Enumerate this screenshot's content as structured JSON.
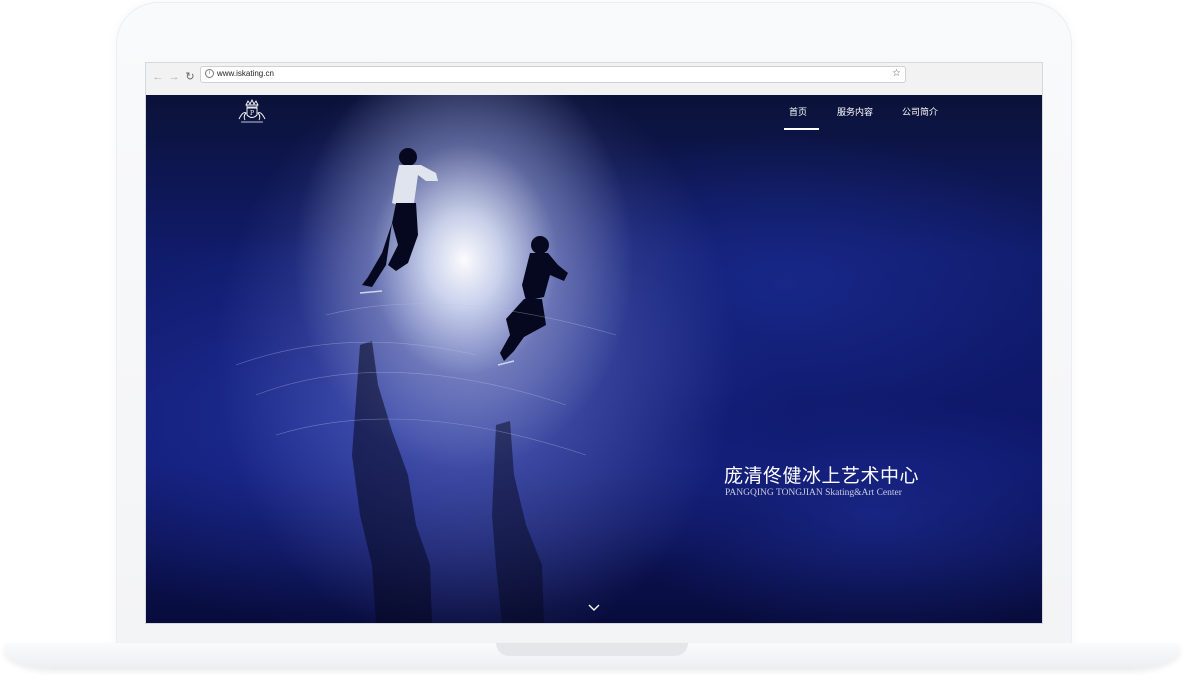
{
  "browser": {
    "url": "www.iskating.cn",
    "back_icon": "arrow-left-icon",
    "forward_icon": "arrow-right-icon",
    "reload_icon": "reload-icon",
    "info_icon": "info-icon",
    "bookmark_icon": "star-icon"
  },
  "header": {
    "logo_icon": "crown-crest-logo",
    "nav": [
      {
        "label": "首页",
        "active": true
      },
      {
        "label": "服务内容",
        "active": false
      },
      {
        "label": "公司简介",
        "active": false
      }
    ]
  },
  "hero": {
    "title": "庞清佟健冰上艺术中心",
    "subtitle": "PANGQING TONGJIAN Skating&Art Center",
    "scroll_icon": "chevron-down-icon"
  },
  "colors": {
    "background": "#0a0f3e",
    "spotlight": "#ffffff",
    "text": "#ffffff"
  }
}
